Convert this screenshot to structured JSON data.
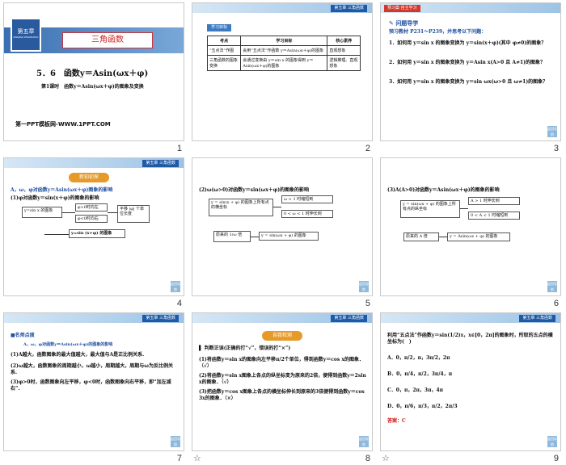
{
  "ribbon": "第五章 三角函数",
  "return_label": "返回导航",
  "s1": {
    "chapter_badge": "第五章",
    "chapter_sub": "SANJIAO ZHANGHAO",
    "title": "三角函数",
    "section": "5．6　函数y＝Asin(ωx＋φ)",
    "lesson": "第1课时　函数y＝Asin(ωx＋φ)的图象及变换",
    "footer": "第一PPT模板网-WWW.1PPT.COM",
    "num": "1"
  },
  "s2": {
    "header": "学习目标",
    "cols": [
      "考点",
      "学习目标",
      "核心素养"
    ],
    "rows": [
      [
        "“五点法”作图",
        "会用“五点法”作函数 y＝Asin(ωx＋φ)的图象",
        "直观想象"
      ],
      [
        "三角函数的图象变换",
        "会通过变换由 y＝sin x 的图象得到 y＝Asin(ωx＋φ)的图象",
        "逻辑推理、直观想象"
      ]
    ],
    "num": "2"
  },
  "s3": {
    "tab": "预习案·自主学习",
    "title": "问题导学",
    "intro": "预习教材 P231～P239，并思考以下问题：",
    "q1": "1．如何用 y＝sin x 的图象变换为 y＝sin(x＋φ)(其中 φ≠0)的图象？",
    "q2": "2．如何用 y＝sin x 的图象变换为 y＝Asin x(A>0 且 A≠1)的图象？",
    "q3": "3．如何用 y＝sin x 的图象变换为 y＝sin ωx(ω>0 且 ω≠1)的图象？",
    "num": "3"
  },
  "s4": {
    "badge": "新知初探",
    "title": "A，ω，φ对函数y＝Asin(ωx＋φ)图象的影响",
    "sub": "(1)φ对函数y＝sin(x＋φ)的图象的影响",
    "b1": "y=sin x 的图象",
    "b2": "φ>0时向左",
    "b3": "φ<0时向右",
    "b4": "平移 |φ| 个单位长度",
    "b5": "y=sin (x+φ) 的图象",
    "num": "4"
  },
  "s5": {
    "title": "(2)ω(ω>0)对函数y＝sin(ωx＋φ)的图象的影响",
    "b1": "y = sin(x + φ) 的图象上所有点的横坐标",
    "b2": "ω > 1 时缩短到",
    "b3": "0 < ω < 1 时伸长到",
    "b4": "原来的 1/ω 倍",
    "b5": "y = sin(ωx + φ) 的图象",
    "num": "5"
  },
  "s6": {
    "title": "(3)A(A>0)对函数y＝Asin(ωx＋φ)的图象的影响",
    "b1": "y = sin(ωx + φ) 的图象上所有点的纵坐标",
    "b2": "A > 1 时伸长到",
    "b3": "0 < A < 1 时缩短到",
    "b4": "原来的 A 倍",
    "b5": "y = Asin(ωx + φ) 的图象",
    "num": "6"
  },
  "s7": {
    "head": "■名师点拨",
    "title": "A，ω，φ对函数y＝Asin(ωx＋φ)的图象的影响",
    "p1": "(1)A越大，函数图象的最大值越大，最大值与A是正比例关系.",
    "p2": "(2)ω越大，函数图象的周期越小，ω越小，周期越大，周期与ω为反比例关系.",
    "p3": "(3)φ>0时，函数图象向左平移，φ<0时，函数图象向右平移，即“加左减右”.",
    "num": "7"
  },
  "s8": {
    "badge": "自我检测",
    "head": "判断正误(正确的打“√”，错误的打“×”)",
    "p1": "(1)将函数y＝sin x的图象向左平移π/2个单位，得到函数y＝cos x的图象．（√）",
    "p2": "(2)将函数y＝sin x图象上各点的纵坐标变为原来的2倍，便得到函数y＝2sin x的图象．（√）",
    "p3": "(3)把函数y＝cos x图象上各点的横坐标伸长到原来的3倍便得到函数y＝cos 3x的图象．（×）",
    "num": "8"
  },
  "s9": {
    "q": "利用“五点法”作函数y＝sin(1/2)x，x∈[0，2π]的图象时，所取的五点的横坐标为(　)",
    "a": "A．0，π/2，π，3π/2，2π",
    "b": "B．0，π/4，π/2，3π/4，π",
    "c": "C．0，π，2π，3π，4π",
    "d": "D．0，π/6，π/3，π/2，2π/3",
    "ans": "答案：C",
    "num": "9"
  }
}
